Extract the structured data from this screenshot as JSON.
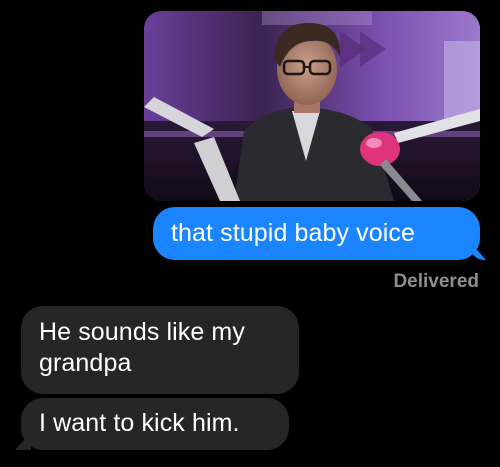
{
  "messages": {
    "attachment": {
      "type": "photo",
      "description_icon": "photo-attachment"
    },
    "sent_text": "that stupid baby voice",
    "delivery_status": "Delivered",
    "received": [
      "He sounds like my grandpa",
      "I want to kick him."
    ]
  },
  "colors": {
    "background": "#000000",
    "sent_bubble": "#1a85ff",
    "received_bubble": "#262629",
    "status_text": "#8d8d93"
  }
}
